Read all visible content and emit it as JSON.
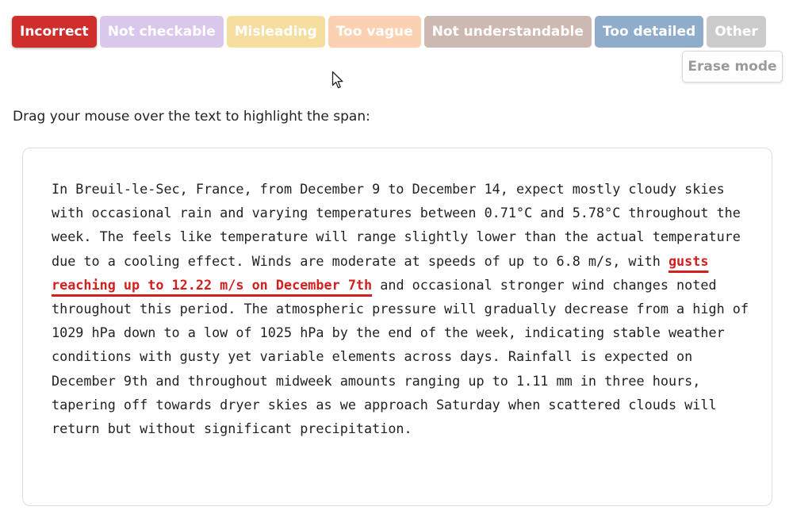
{
  "labels": {
    "buttons": [
      {
        "label": "Incorrect",
        "color": "#d02d2d",
        "active": true
      },
      {
        "label": "Not checkable",
        "color": "#d9c8ec",
        "active": false
      },
      {
        "label": "Misleading",
        "color": "#f5dea0",
        "active": false
      },
      {
        "label": "Too vague",
        "color": "#fcd1b2",
        "active": false
      },
      {
        "label": "Not understandable",
        "color": "#cdb9b1",
        "active": false
      },
      {
        "label": "Too detailed",
        "color": "#8faccb",
        "active": false
      },
      {
        "label": "Other",
        "color": "#cbcbcb",
        "active": false
      }
    ],
    "erase_mode": "Erase mode"
  },
  "instruction": "Drag your mouse over the text to highlight the span:",
  "passage": {
    "before": "In Breuil-le-Sec, France, from December 9 to December 14, expect mostly cloudy skies with occasional rain and varying temperatures between 0.71°C and 5.78°C throughout the week. The feels like temperature will range slightly lower than the actual temperature due to a cooling effect. Winds are moderate at speeds of up to 6.8 m/s, with ",
    "highlighted": "gusts reaching up to 12.22 m/s on December 7th",
    "after": " and occasional stronger wind changes noted throughout this period. The atmospheric pressure will gradually decrease from a high of 1029 hPa down to a low of 1025 hPa by the end of the week, indicating stable weather conditions with gusty yet variable elements across days. Rainfall is expected on December 9th and throughout midweek amounts ranging up to 1.11 mm in three hours, tapering off towards dryer skies as we approach Saturday when scattered clouds will return but without significant precipitation."
  },
  "colors": {
    "highlight": "#d21f1f"
  }
}
